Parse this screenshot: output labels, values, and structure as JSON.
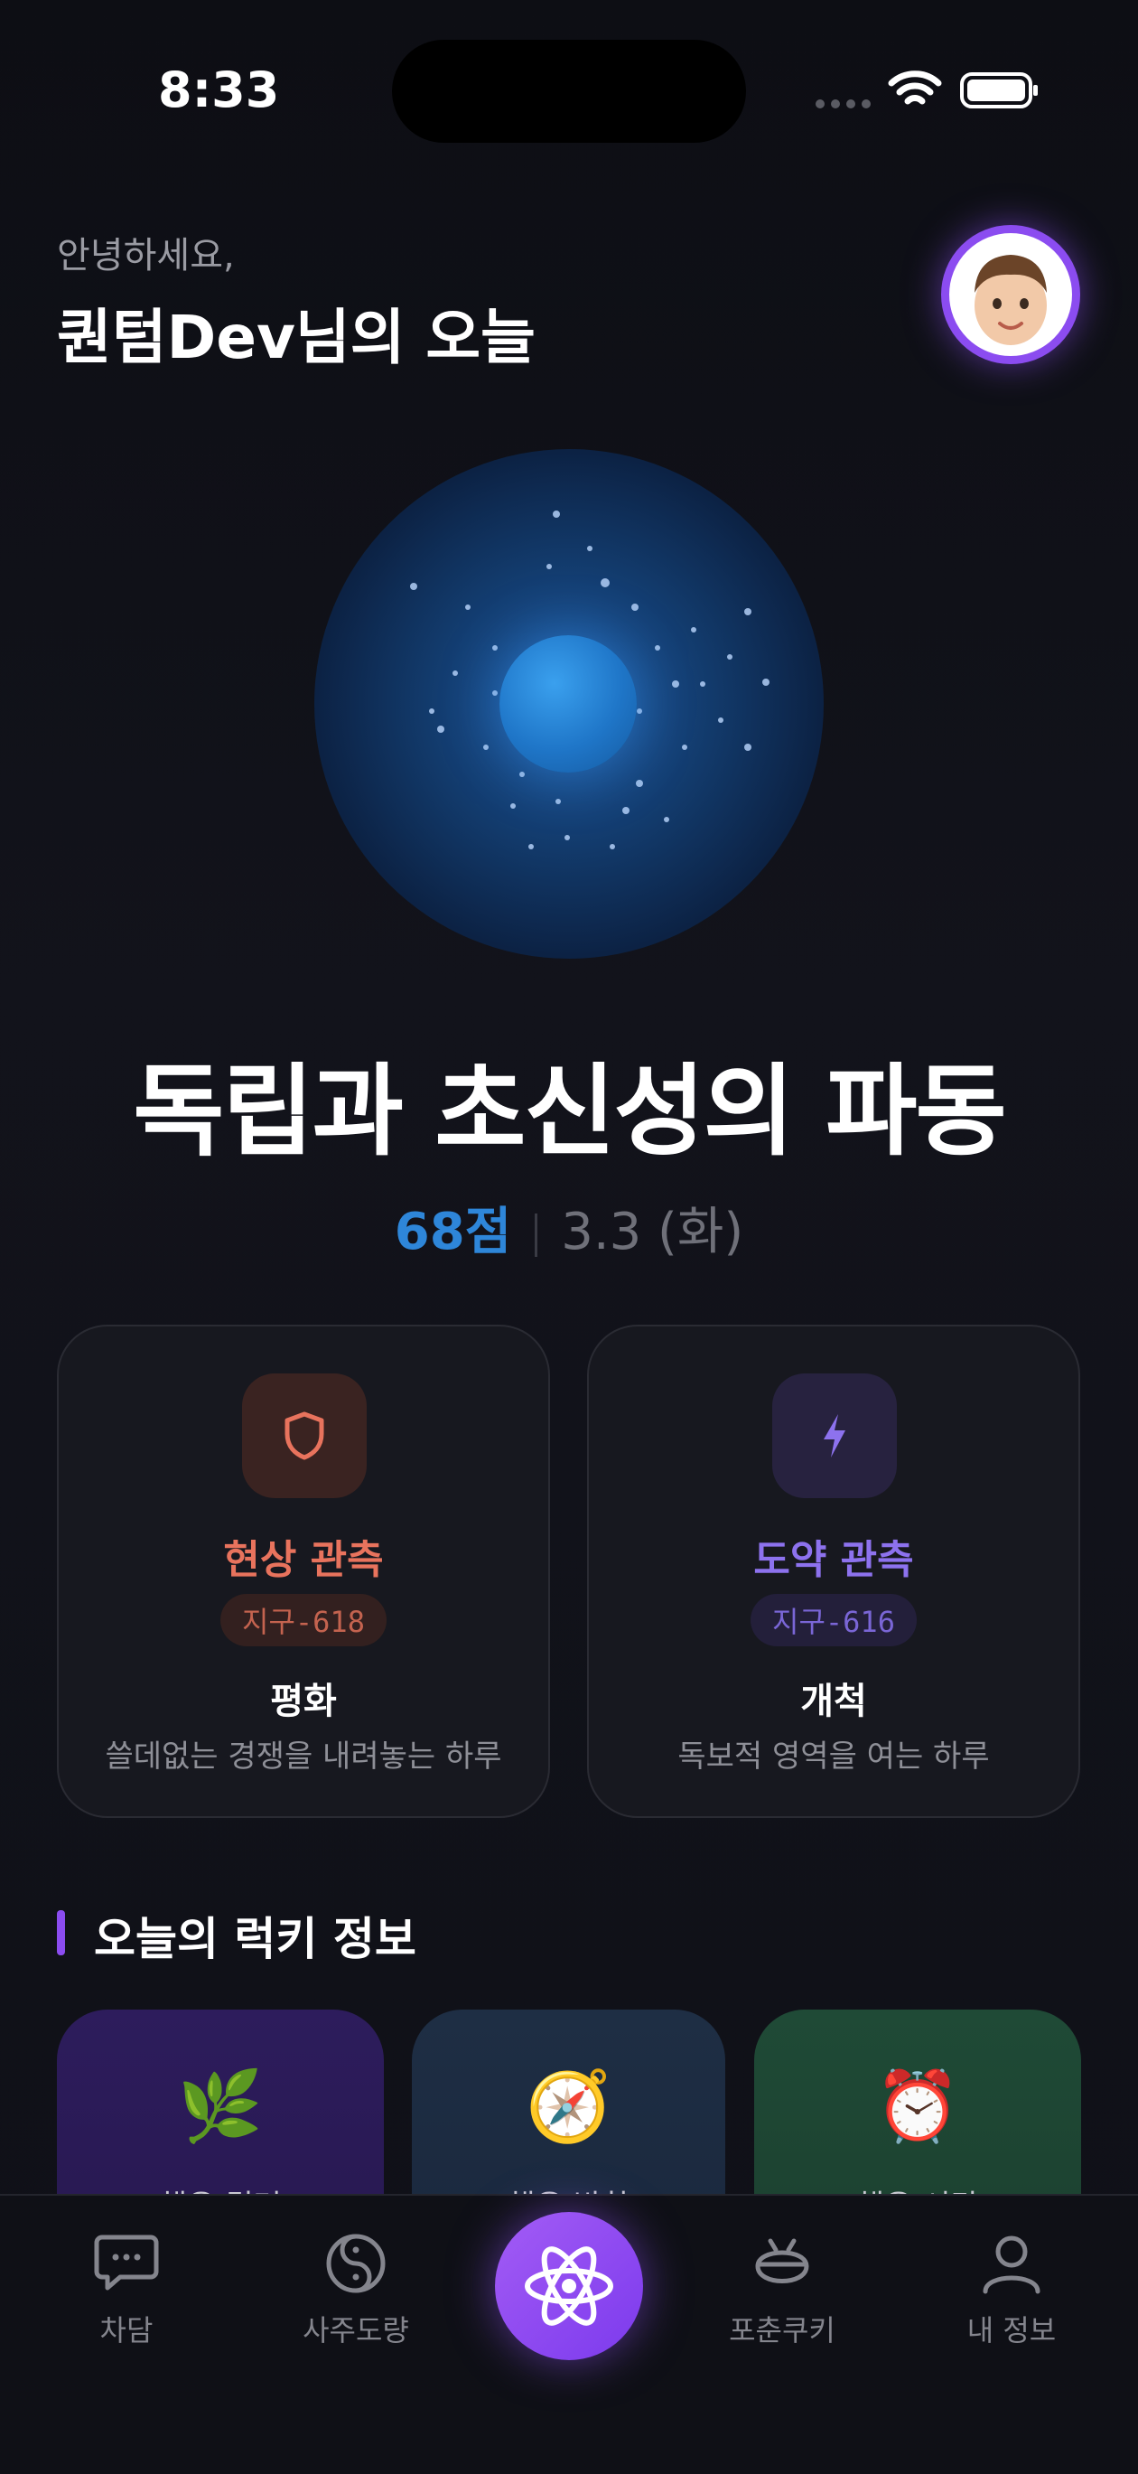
{
  "status": {
    "time": "8:33"
  },
  "header": {
    "greeting": "안녕하세요,",
    "title": "퀀텀Dev님의 오늘"
  },
  "hero": {
    "title": "독립과 초신성의 파동",
    "score": "68점",
    "date": "3.3 (화)"
  },
  "cards": [
    {
      "icon": "shield-icon",
      "title": "현상 관측",
      "tag": "지구-618",
      "name": "평화",
      "desc": "쓸데없는 경쟁을 내려놓는 하루",
      "color": "#e8735d"
    },
    {
      "icon": "lightning-icon",
      "title": "도약 관측",
      "tag": "지구-616",
      "name": "개척",
      "desc": "독보적 영역을 여는 하루",
      "color": "#8d72ee"
    }
  ],
  "lucky": {
    "title": "오늘의 럭키 정보",
    "items": [
      {
        "emoji": "🌿",
        "icon": "herb-icon",
        "label": "행운 컬러"
      },
      {
        "emoji": "🧭",
        "icon": "compass-icon",
        "label": "행운 방향"
      },
      {
        "emoji": "⏰",
        "icon": "alarm-clock-icon",
        "label": "행운 시간"
      }
    ]
  },
  "tabs": [
    {
      "label": "차담",
      "icon": "chat-icon"
    },
    {
      "label": "사주도량",
      "icon": "yin-yang-icon"
    },
    {
      "label": "",
      "icon": "atom-icon"
    },
    {
      "label": "포춘쿠키",
      "icon": "fortune-cookie-icon"
    },
    {
      "label": "내 정보",
      "icon": "person-icon"
    }
  ],
  "colors": {
    "accent": "#8b4cf0",
    "score": "#2e86d9"
  }
}
